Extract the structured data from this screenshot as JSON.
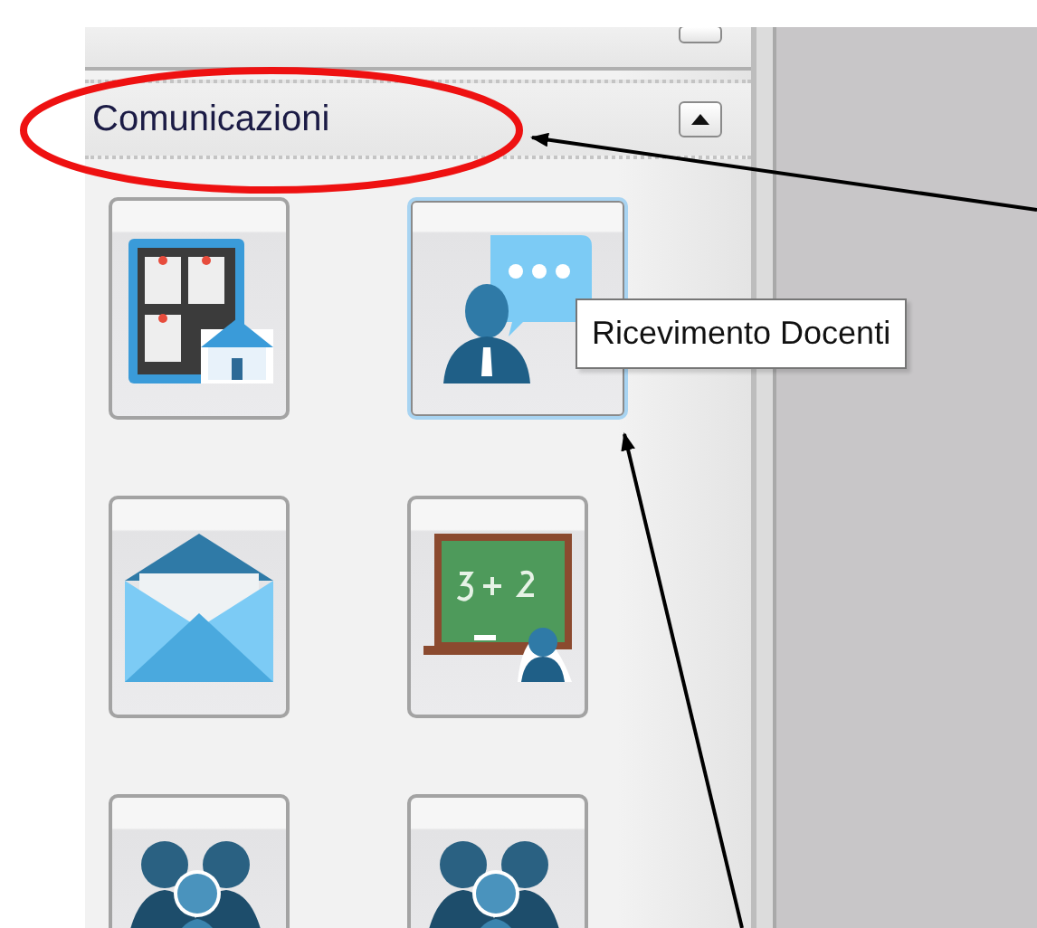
{
  "sections": [
    {
      "expanded": false
    },
    {
      "title": "Comunicazioni",
      "expanded": true
    }
  ],
  "tiles": [
    {
      "kind": "bulletin",
      "hovered": false
    },
    {
      "kind": "meeting",
      "hovered": true
    },
    {
      "kind": "mail",
      "hovered": false
    },
    {
      "kind": "blackboard",
      "hovered": false
    },
    {
      "kind": "group-screen",
      "hovered": false
    },
    {
      "kind": "group-board",
      "hovered": false
    }
  ],
  "tooltip": {
    "text": "Ricevimento Docenti"
  }
}
